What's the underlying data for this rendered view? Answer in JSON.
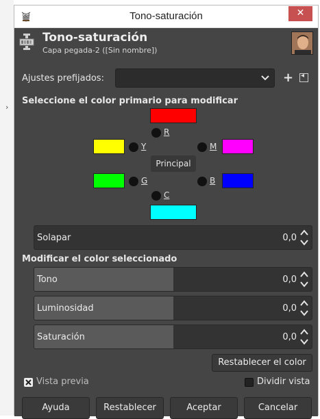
{
  "window": {
    "title": "Tono-saturación",
    "close_glyph": "✕"
  },
  "header": {
    "title": "Tono-saturación",
    "subtitle": "Capa pegada-2 ([Sin nombre])"
  },
  "presets": {
    "label": "Ajustes prefijados:",
    "value": "",
    "add_glyph": "+",
    "menu_glyph": "◂"
  },
  "primary": {
    "heading": "Seleccione el color primario para modificar",
    "principal_label": "Principal",
    "colors": [
      {
        "key": "R",
        "label": "R",
        "hex": "#ff0000"
      },
      {
        "key": "Y",
        "label": "Y",
        "hex": "#ffff00"
      },
      {
        "key": "M",
        "label": "M",
        "hex": "#ff00ff"
      },
      {
        "key": "G",
        "label": "G",
        "hex": "#00ff00"
      },
      {
        "key": "B",
        "label": "B",
        "hex": "#0000ff"
      },
      {
        "key": "C",
        "label": "C",
        "hex": "#00ffff"
      }
    ]
  },
  "overlap": {
    "label": "Solapar",
    "value": "0,0",
    "fill_fraction": 0.0
  },
  "modify": {
    "heading": "Modificar el color seleccionado",
    "sliders": [
      {
        "label": "Tono",
        "value": "0,0",
        "fill_fraction": 0.5
      },
      {
        "label": "Luminosidad",
        "value": "0,0",
        "fill_fraction": 0.5
      },
      {
        "label": "Saturación",
        "value": "0,0",
        "fill_fraction": 0.5
      }
    ],
    "reset_color_label": "Restablecer el color"
  },
  "options": {
    "preview_label": "Vista previa",
    "preview_checked": true,
    "split_label": "Dividir vista",
    "split_checked": false
  },
  "buttons": {
    "help": "Ayuda",
    "reset": "Restablecer",
    "ok": "Aceptar",
    "cancel": "Cancelar"
  },
  "colors": {
    "panel_bg": "#454545",
    "close_button": "#c75050"
  },
  "icons": {
    "title": "gimp-wilber-icon",
    "header": "hue-saturation-icon",
    "preset_chevron": "chevron-down-icon",
    "preset_add": "plus-icon",
    "preset_menu": "menu-arrow-icon",
    "spin_up": "chevron-up-icon",
    "spin_down": "chevron-down-icon"
  }
}
